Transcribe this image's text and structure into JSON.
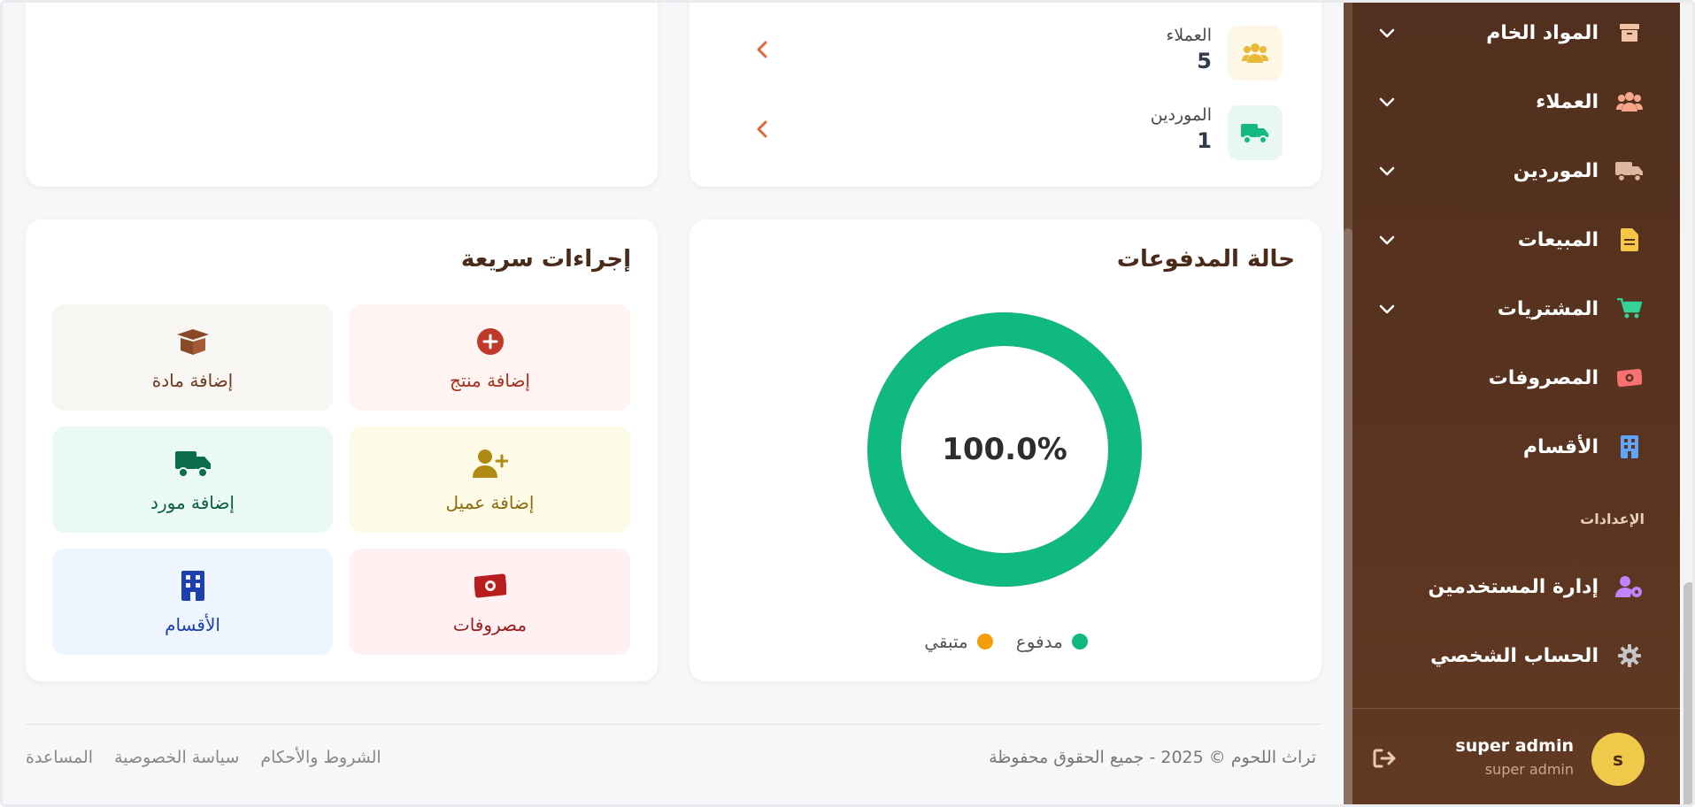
{
  "stats": [
    {
      "label": "العملاء",
      "value": "5",
      "icon": "users-icon",
      "color": "#e9b93a",
      "bg": "#fdf8e6"
    },
    {
      "label": "الموردين",
      "value": "1",
      "icon": "truck-icon",
      "color": "#15b981",
      "bg": "#e8f8f1"
    }
  ],
  "payments": {
    "title": "حالة المدفوعات",
    "percent_label": "100.0%",
    "paid_fraction": 1.0,
    "legend": [
      {
        "label": "مدفوع",
        "color": "#10b981"
      },
      {
        "label": "متبقي",
        "color": "#f59e0b"
      }
    ]
  },
  "quick_actions": {
    "title": "إجراءات سريعة",
    "items": [
      {
        "label": "إضافة منتج",
        "icon": "plus-circle-icon",
        "color": "#c0392b",
        "bg": "#fff4f1",
        "text": "#a5321f"
      },
      {
        "label": "إضافة مادة",
        "icon": "box-open-icon",
        "color": "#8a4a2a",
        "bg": "#f8f6f3",
        "text": "#6b3a1f"
      },
      {
        "label": "إضافة عميل",
        "icon": "user-plus-icon",
        "color": "#b08a12",
        "bg": "#fdfae8",
        "text": "#8b6d12"
      },
      {
        "label": "إضافة مورد",
        "icon": "truck-icon",
        "color": "#0b6b4b",
        "bg": "#eafaf3",
        "text": "#0b5c41"
      },
      {
        "label": "مصروفات",
        "icon": "money-bill-icon",
        "color": "#b91c1c",
        "bg": "#fff1f1",
        "text": "#9b1c1c"
      },
      {
        "label": "الأقسام",
        "icon": "building-icon",
        "color": "#1e40af",
        "bg": "#eef5ff",
        "text": "#1e40af"
      }
    ]
  },
  "sidebar": {
    "items": [
      {
        "label": "المواد الخام",
        "icon": "box-icon",
        "color": "#f2c4a6",
        "has_chevron": true
      },
      {
        "label": "العملاء",
        "icon": "users-icon",
        "color": "#f6a78c",
        "has_chevron": true
      },
      {
        "label": "الموردين",
        "icon": "truck-icon",
        "color": "#e0b7a1",
        "has_chevron": true
      },
      {
        "label": "المبيعات",
        "icon": "file-invoice-icon",
        "color": "#f6c744",
        "has_chevron": true
      },
      {
        "label": "المشتريات",
        "icon": "cart-icon",
        "color": "#34d399",
        "has_chevron": true
      },
      {
        "label": "المصروفات",
        "icon": "money-bill-icon",
        "color": "#f87171",
        "has_chevron": false
      },
      {
        "label": "الأقسام",
        "icon": "building-icon",
        "color": "#60a5fa",
        "has_chevron": false
      }
    ],
    "settings_heading": "الإعدادات",
    "settings_items": [
      {
        "label": "إدارة المستخدمين",
        "icon": "user-gear-icon",
        "color": "#c084fc"
      },
      {
        "label": "الحساب الشخصي",
        "icon": "gear-icon",
        "color": "#c7c7c7"
      }
    ],
    "user": {
      "initial": "s",
      "name": "super admin",
      "role": "super admin"
    }
  },
  "footer": {
    "copyright": "تراث اللحوم © 2025 - جميع الحقوق محفوظة",
    "links": [
      "الشروط والأحكام",
      "سياسة الخصوصية",
      "المساعدة"
    ]
  }
}
